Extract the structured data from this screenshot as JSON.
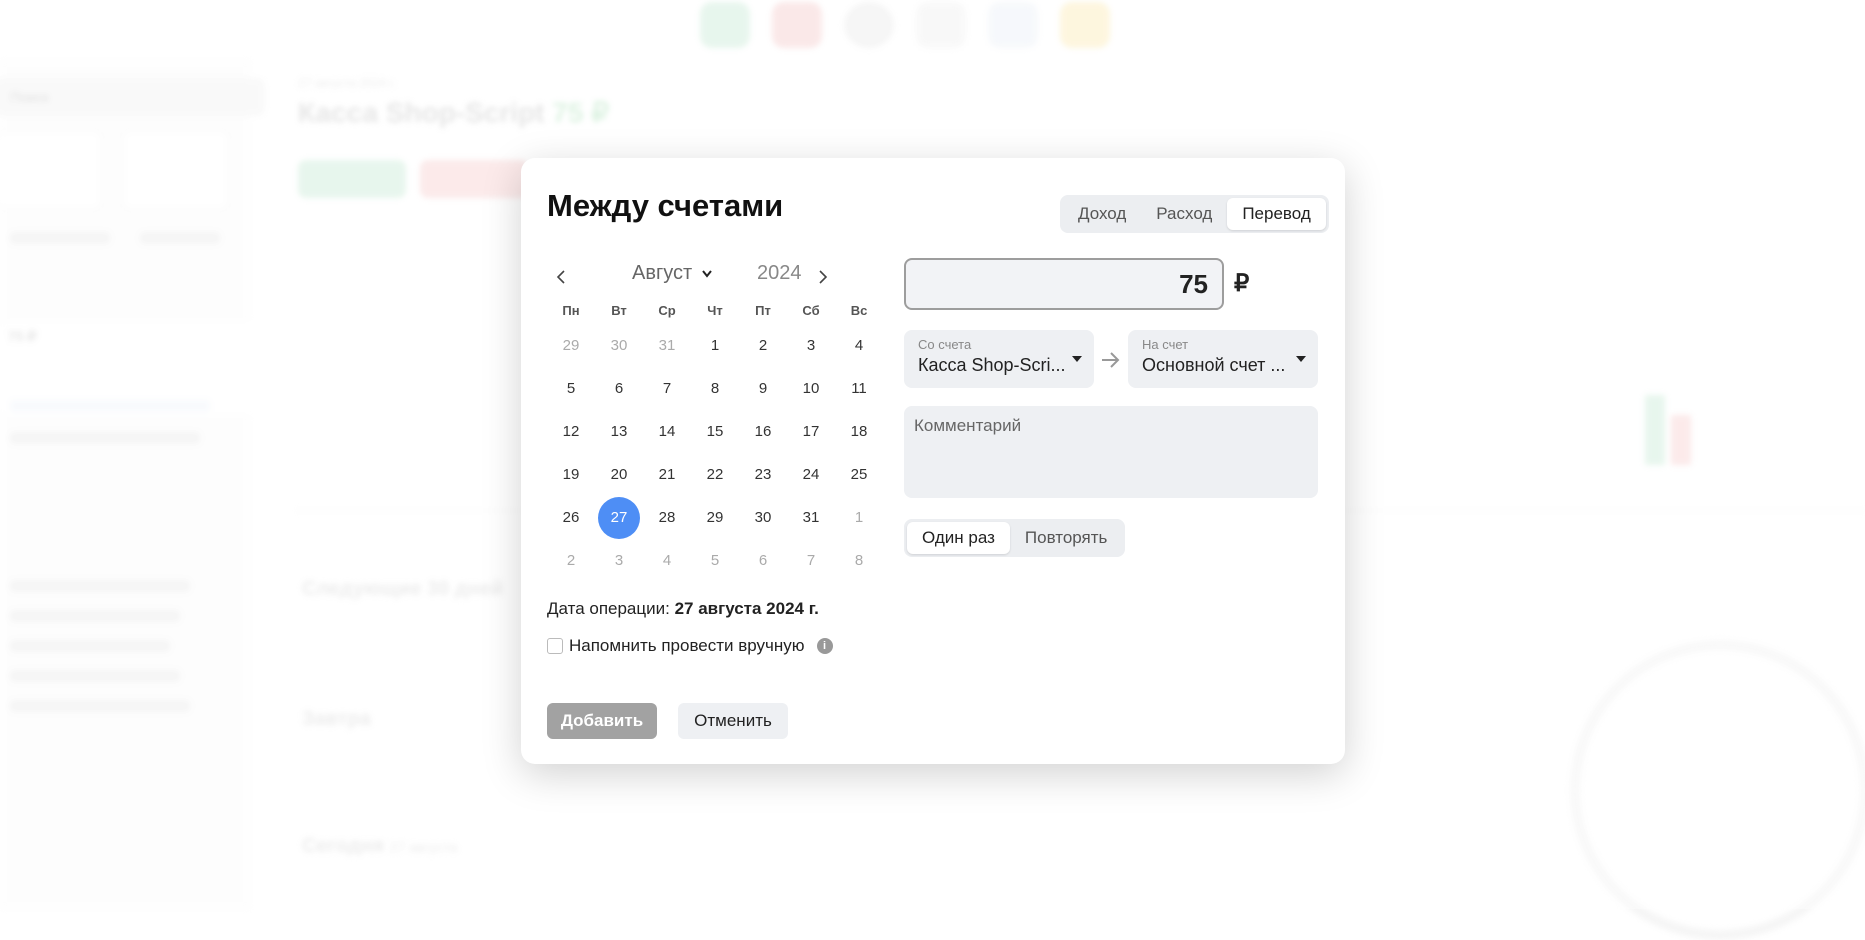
{
  "dialog": {
    "title": "Между счетами",
    "type_tabs": [
      "Доход",
      "Расход",
      "Перевод"
    ],
    "active_type": "Перевод",
    "calendar": {
      "month": "Август",
      "year": "2024",
      "weekdays": [
        "Пн",
        "Вт",
        "Ср",
        "Чт",
        "Пт",
        "Сб",
        "Вс"
      ],
      "days": [
        {
          "d": "29",
          "m": true
        },
        {
          "d": "30",
          "m": true
        },
        {
          "d": "31",
          "m": true
        },
        {
          "d": "1"
        },
        {
          "d": "2"
        },
        {
          "d": "3"
        },
        {
          "d": "4"
        },
        {
          "d": "5"
        },
        {
          "d": "6"
        },
        {
          "d": "7"
        },
        {
          "d": "8"
        },
        {
          "d": "9"
        },
        {
          "d": "10"
        },
        {
          "d": "11"
        },
        {
          "d": "12"
        },
        {
          "d": "13"
        },
        {
          "d": "14"
        },
        {
          "d": "15"
        },
        {
          "d": "16"
        },
        {
          "d": "17"
        },
        {
          "d": "18"
        },
        {
          "d": "19"
        },
        {
          "d": "20"
        },
        {
          "d": "21"
        },
        {
          "d": "22"
        },
        {
          "d": "23"
        },
        {
          "d": "24"
        },
        {
          "d": "25"
        },
        {
          "d": "26"
        },
        {
          "d": "27",
          "sel": true
        },
        {
          "d": "28"
        },
        {
          "d": "29"
        },
        {
          "d": "30"
        },
        {
          "d": "31"
        },
        {
          "d": "1",
          "m": true
        },
        {
          "d": "2",
          "m": true
        },
        {
          "d": "3",
          "m": true
        },
        {
          "d": "4",
          "m": true
        },
        {
          "d": "5",
          "m": true
        },
        {
          "d": "6",
          "m": true
        },
        {
          "d": "7",
          "m": true
        },
        {
          "d": "8",
          "m": true
        }
      ],
      "selected_day": "27"
    },
    "op_date_label": "Дата операции:",
    "op_date_value": "27 августа 2024 г.",
    "remind_label": "Напомнить провести вручную",
    "remind_checked": false,
    "amount": "75",
    "currency": "₽",
    "from_account": {
      "label": "Со счета",
      "value": "Касса Shop-Scri..."
    },
    "to_account": {
      "label": "На счет",
      "value": "Основной счет ..."
    },
    "comment_placeholder": "Комментарий",
    "repeat_tabs": [
      "Один раз",
      "Повторять"
    ],
    "active_repeat": "Один раз",
    "add_button": "Добавить",
    "cancel_button": "Отменить"
  },
  "background": {
    "page_title": "Касса Shop-Script",
    "page_amount": "75 ₽",
    "page_date": "27 августа 2024 г.",
    "search_placeholder": "Поиск",
    "section_next": "Следующие 30 дней",
    "section_tomorrow": "Завтра",
    "section_today": "Сегодня",
    "today_date": "27 августа",
    "side_balance": "75 ₽"
  },
  "colors": {
    "accent": "#4e8ef5",
    "add_button_bg": "#a2a2a2",
    "field_bg": "#eef0f3"
  }
}
